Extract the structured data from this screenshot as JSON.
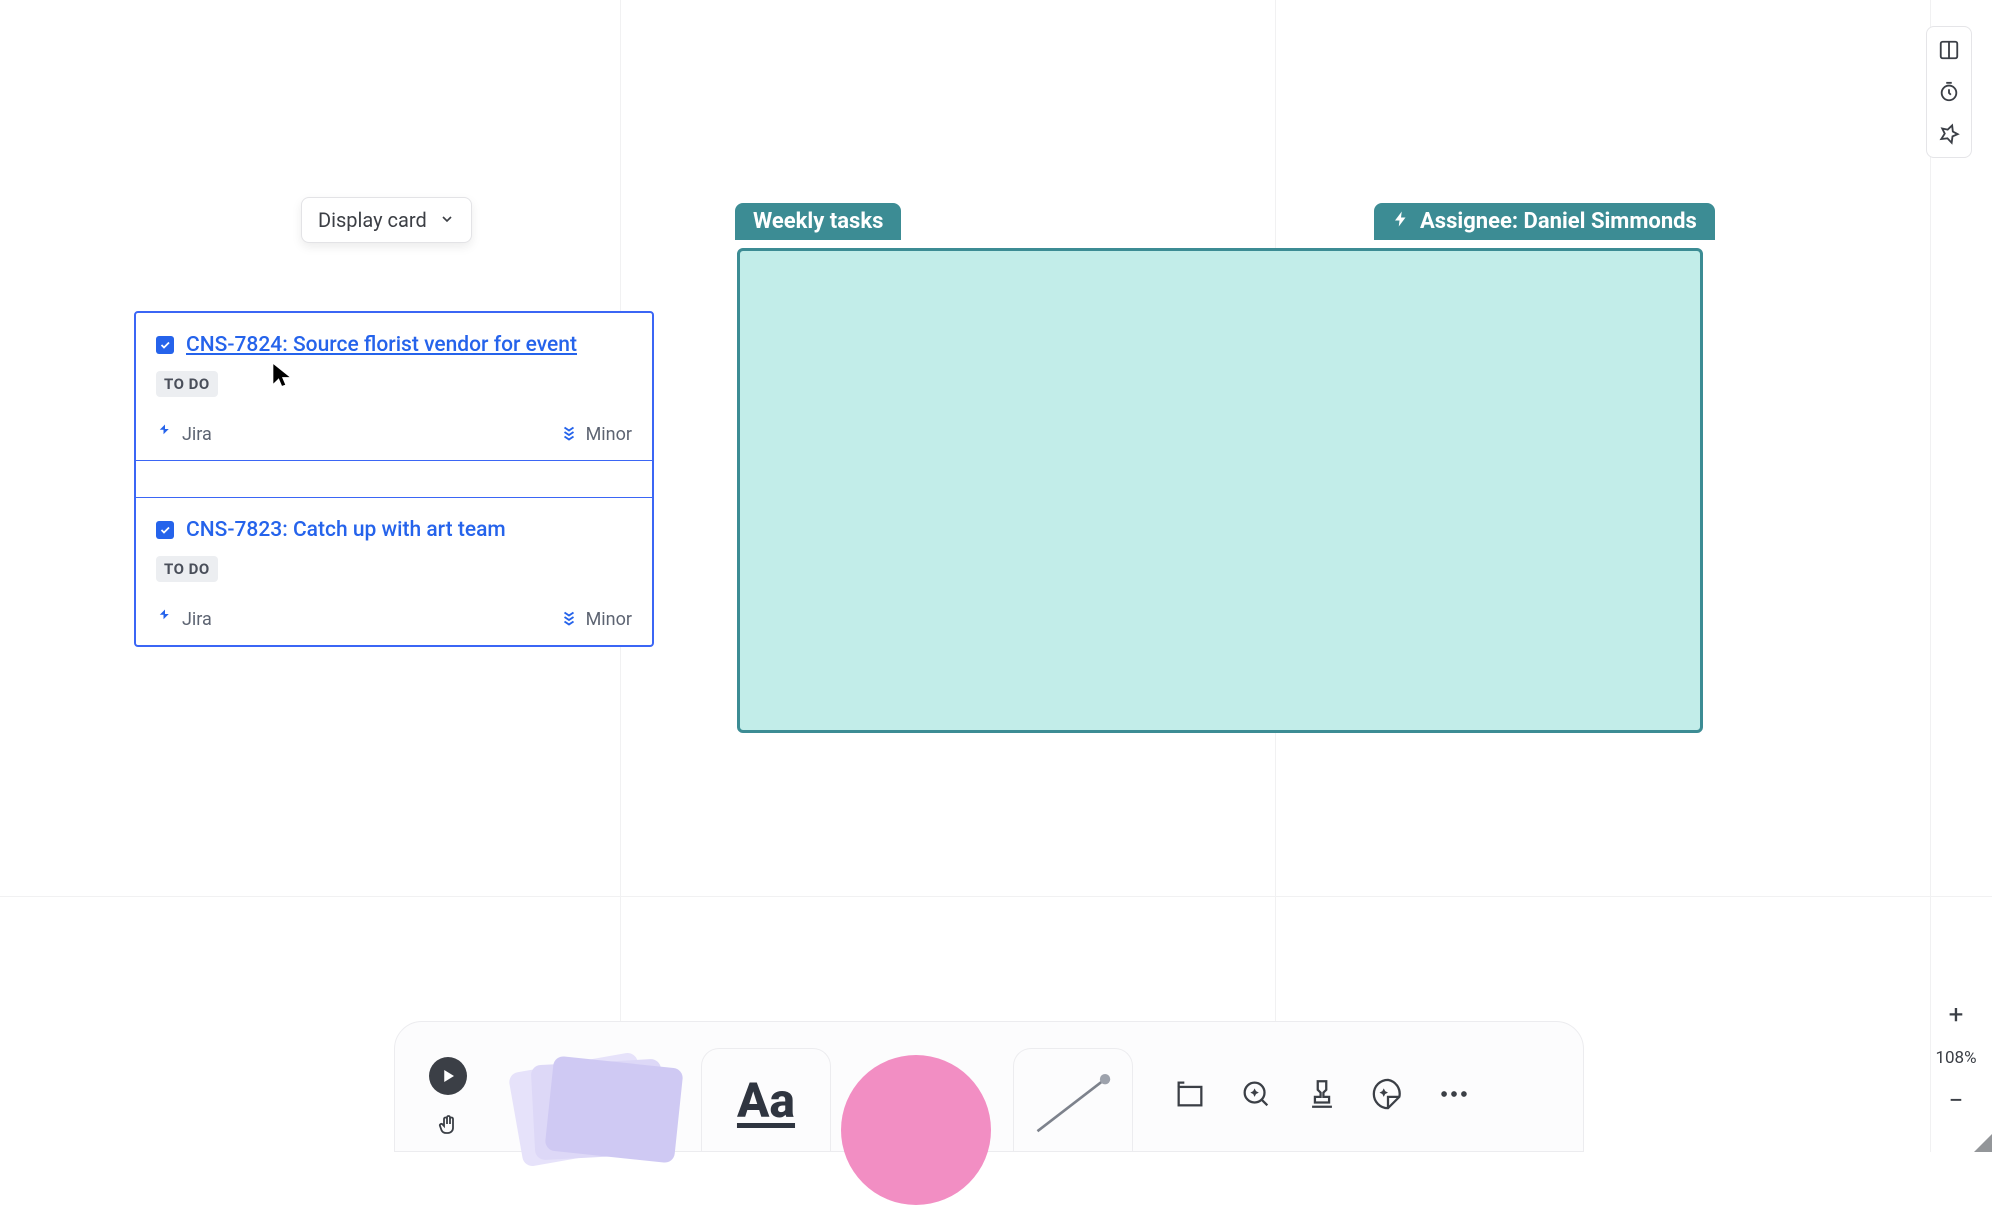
{
  "dropdown": {
    "label": "Display card"
  },
  "tasks": [
    {
      "id": "CNS-7824",
      "title": "CNS-7824: Source florist vendor for event",
      "status": "TO DO",
      "source": "Jira",
      "priority": "Minor",
      "linked": true
    },
    {
      "id": "CNS-7823",
      "title": "CNS-7823: Catch up with art team",
      "status": "TO DO",
      "source": "Jira",
      "priority": "Minor",
      "linked": false
    }
  ],
  "section": {
    "label": "Weekly tasks",
    "assignee_prefix": "Assignee: ",
    "assignee_name": "Daniel Simmonds"
  },
  "toolbar": {
    "text_tool": "Aa"
  },
  "zoom": {
    "plus": "+",
    "minus": "−",
    "value": "108%"
  }
}
